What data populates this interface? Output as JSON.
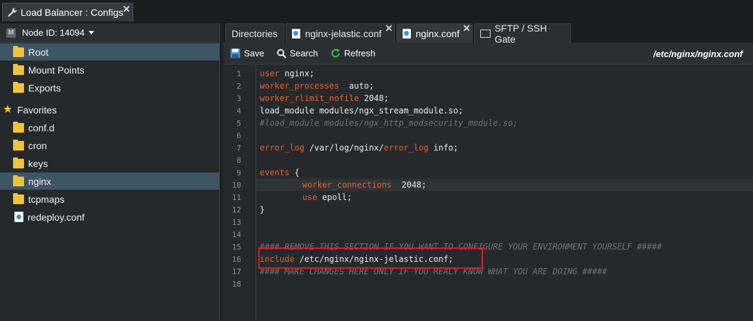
{
  "window": {
    "title": "Load Balancer : Configs",
    "close": "✕"
  },
  "node": {
    "icon_letter": "M",
    "label": "Node ID: 14094"
  },
  "tree": {
    "items": [
      {
        "label": "Root",
        "icon": "folder-icon"
      },
      {
        "label": "Mount Points",
        "icon": "folder-icon"
      },
      {
        "label": "Exports",
        "icon": "link-folder-icon"
      }
    ],
    "favorites_label": "Favorites",
    "favorites": [
      {
        "label": "conf.d",
        "icon": "folder-icon"
      },
      {
        "label": "cron",
        "icon": "folder-icon"
      },
      {
        "label": "keys",
        "icon": "folder-icon"
      },
      {
        "label": "nginx",
        "icon": "folder-icon"
      },
      {
        "label": "tcpmaps",
        "icon": "folder-icon"
      },
      {
        "label": "redeploy.conf",
        "icon": "file-icon"
      }
    ]
  },
  "tabs": [
    {
      "label": "Directories"
    },
    {
      "label": "nginx-jelastic.conf"
    },
    {
      "label": "nginx.conf"
    },
    {
      "label": "SFTP / SSH Gate"
    }
  ],
  "toolbar": {
    "save": "Save",
    "search": "Search",
    "refresh": "Refresh",
    "path": "/etc/nginx/nginx.conf"
  },
  "editor": {
    "line_numbers": [
      "1",
      "2",
      "3",
      "4",
      "5",
      "6",
      "7",
      "8",
      "9",
      "10",
      "11",
      "12",
      "13",
      "14",
      "15",
      "16",
      "17",
      "18"
    ],
    "lines": {
      "l1_kw": "user",
      "l1_rest": " nginx;",
      "l2_kw": "worker_processes",
      "l2_rest": "  auto;",
      "l3_kw": "worker_rlimit_nofile",
      "l3_rest": " 2048;",
      "l4": "load_module modules/ngx_stream_module.so;",
      "l5": "#load_module modules/ngx_http_modsecurity_module.so;",
      "l7_kw": "error_log",
      "l7_mid": " /var/log/nginx/",
      "l7_kw2": "error_log",
      "l7_rest": " info;",
      "l9_kw": "events",
      "l9_rest": " {",
      "l10_kw": "worker_connections",
      "l10_rest": "  2048;",
      "l11_kw": "use",
      "l11_rest": " epoll;",
      "l12": "}",
      "l15": "#### REMOVE THIS SECTION IF YOU WANT TO CONFIGURE YOUR ENVIRONMENT YOURSELF #####",
      "l16_kw": "include",
      "l16_rest": " /etc/nginx/nginx-jelastic.conf;",
      "l17": "#### MAKE CHANGES HERE ONLY IF YOU REALY KNOW WHAT YOU ARE DOING #####"
    }
  },
  "colors": {
    "keyword": "#e0622f",
    "comment": "#6b7378",
    "selection": "#3e5566",
    "highlight": "#d91f26"
  }
}
